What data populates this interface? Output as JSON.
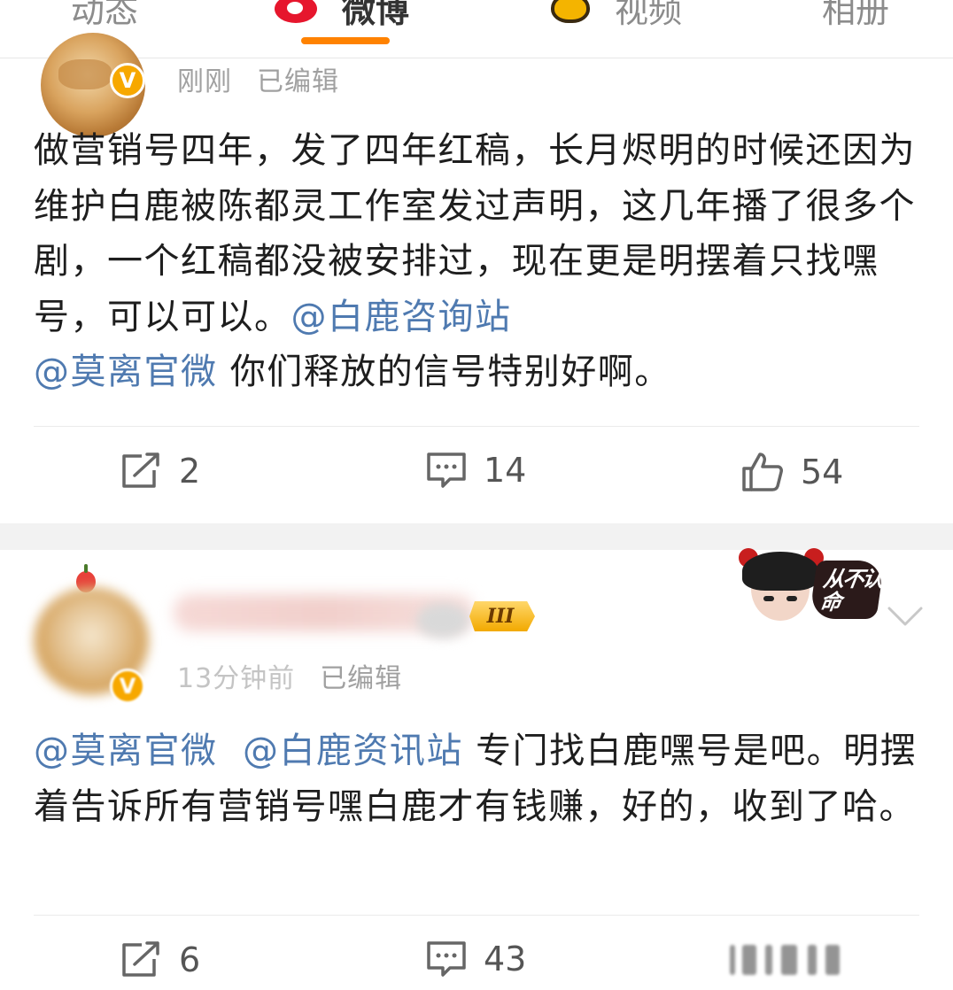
{
  "tabs": [
    {
      "label": "动态",
      "active": false
    },
    {
      "label": "微博",
      "active": true
    },
    {
      "label": "视频",
      "active": false
    },
    {
      "label": "相册",
      "active": false
    }
  ],
  "colors": {
    "active_tab_underline": "#ff8200",
    "mention": "#4f7ab0",
    "verified_badge": "#f7a800",
    "secondary_text": "#a0a0a0"
  },
  "posts": [
    {
      "verified_badge": "V",
      "time": "刚刚",
      "edited": "已编辑",
      "text_before": "做营销号四年，发了四年红稿，长月烬明的时候还因为维护白鹿被陈都灵工作室发过声明，这几年播了很多个剧，一个红稿都没被安排过，现在更是明摆着只找嘿号，可以可以。",
      "mention_1": "@白鹿咨询站",
      "mention_2": "@莫离官微",
      "text_after": "你们释放的信号特别好啊。",
      "reposts": "2",
      "comments": "14",
      "likes": "54"
    },
    {
      "verified_badge": "V",
      "level_badge": "III",
      "time": "13分钟前",
      "edited": "已编辑",
      "mention_1": "@莫离官微",
      "mention_2": "@白鹿资讯站",
      "text_after": "专门找白鹿嘿号是吧。明摆着告诉所有营销号嘿白鹿才有钱赚，好的，收到了哈。",
      "reposts": "6",
      "comments": "43",
      "pendant_text": "从不认命"
    }
  ],
  "icons": {
    "repost": "repost-icon",
    "comment": "comment-icon",
    "like": "thumbs-up-icon",
    "more": "chevron-down-icon"
  }
}
